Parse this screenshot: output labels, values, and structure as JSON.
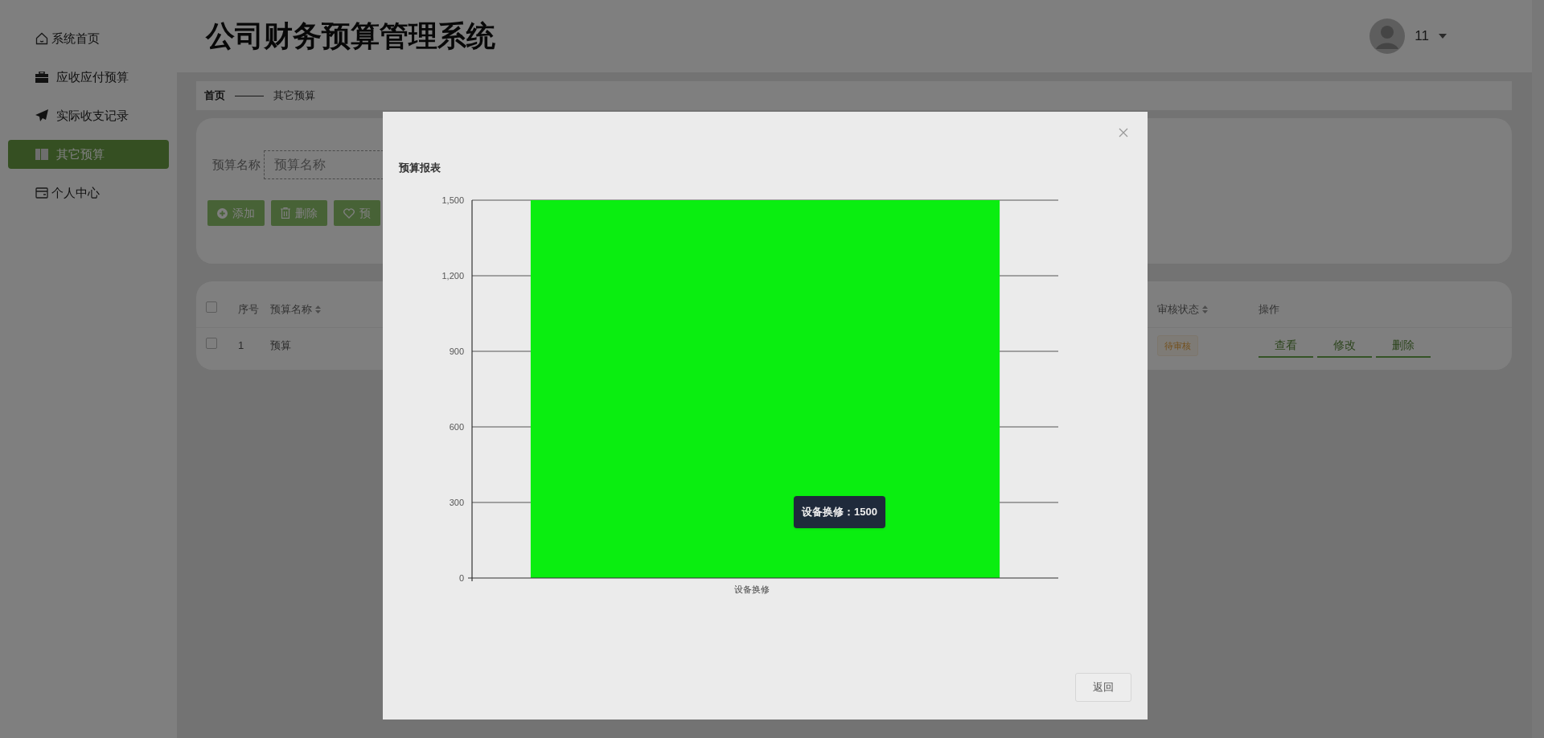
{
  "sidebar": {
    "items": [
      {
        "label": "系统首页",
        "selected": false
      },
      {
        "label": "应收应付预算",
        "selected": false
      },
      {
        "label": "实际收支记录",
        "selected": false
      },
      {
        "label": "其它预算",
        "selected": true
      },
      {
        "label": "个人中心",
        "selected": false
      }
    ]
  },
  "header": {
    "title": "公司财务预算管理系统",
    "user": "11"
  },
  "breadcrumb": [
    "首页",
    "其它预算"
  ],
  "search": {
    "label": "预算名称",
    "placeholder": "预算名称"
  },
  "toolbar": [
    {
      "label": "添加"
    },
    {
      "label": "删除"
    },
    {
      "label": "预"
    }
  ],
  "table": {
    "header_checked": false,
    "columns": [
      {
        "label": "序号",
        "sortable": false
      },
      {
        "label": "预算名称",
        "sortable": true
      },
      {
        "label": "审核状态",
        "sortable": true
      },
      {
        "label": "操作",
        "sortable": false
      }
    ],
    "rows": [
      {
        "checked": false,
        "cells": [
          "1",
          "预算"
        ],
        "status": "待审核",
        "actions": [
          "查看",
          "修改",
          "删除"
        ]
      }
    ]
  },
  "modal": {
    "title": "预算报表",
    "tooltip": "设备换修：1500",
    "button": "返回",
    "chart_data": {
      "type": "bar",
      "grid": true,
      "categories": [
        "设备换修"
      ],
      "values": [
        1500
      ],
      "ylim": [
        0,
        1500
      ],
      "yticks": [
        {
          "value": 0,
          "label": "0"
        },
        {
          "value": 300,
          "label": "300"
        },
        {
          "value": 600,
          "label": "600"
        },
        {
          "value": 900,
          "label": "900"
        },
        {
          "value": 1200,
          "label": "1,200"
        },
        {
          "value": 1500,
          "label": "1,500"
        }
      ]
    }
  }
}
